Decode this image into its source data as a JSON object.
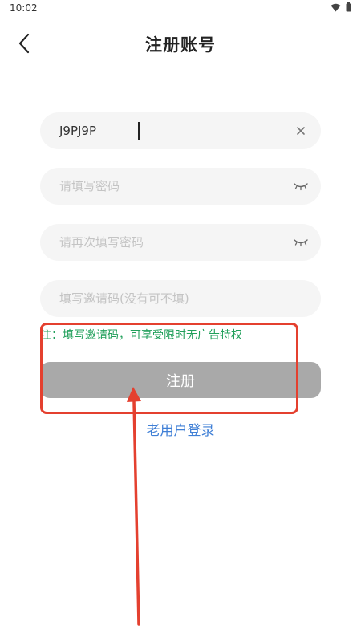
{
  "status_bar": {
    "time": "10:02"
  },
  "header": {
    "title": "注册账号"
  },
  "form": {
    "username": {
      "value": "J9PJ9P",
      "placeholder": ""
    },
    "password": {
      "placeholder": "请填写密码"
    },
    "confirm_password": {
      "placeholder": "请再次填写密码"
    },
    "invite_code": {
      "placeholder": "填写邀请码(没有可不填)"
    },
    "hint": "注：填写邀请码，可享受限时无广告特权",
    "submit_label": "注册",
    "login_link": "老用户登录"
  },
  "colors": {
    "hint": "#21a05b",
    "button_bg": "#a9a9a9",
    "link": "#3f7fd6",
    "annotation": "#e4402f"
  },
  "icons": {
    "back": "chevron-left-icon",
    "clear": "close-icon",
    "password_visibility": "eye-closed-icon",
    "wifi": "wifi-icon",
    "battery": "battery-icon"
  }
}
